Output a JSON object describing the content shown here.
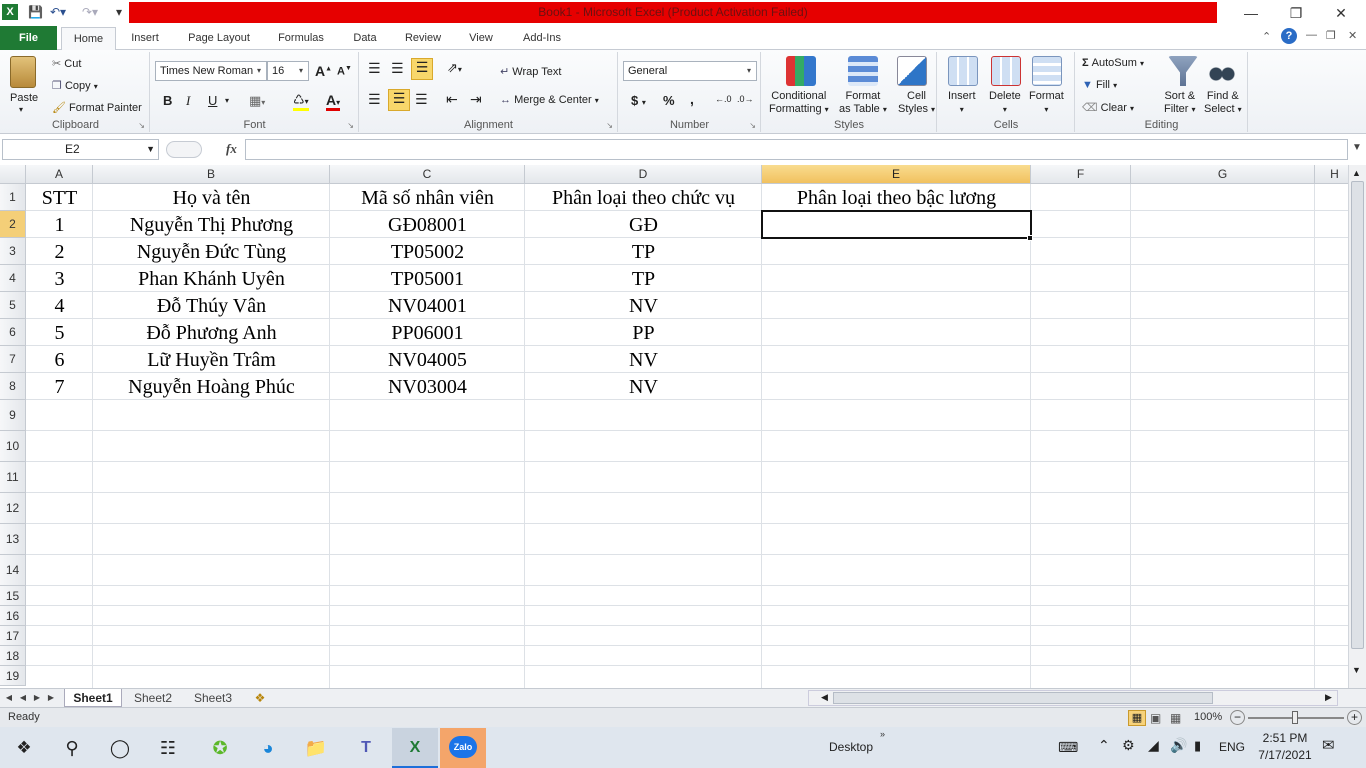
{
  "window": {
    "title": "Book1  -  Microsoft Excel (Product Activation Failed)"
  },
  "tabs": [
    "File",
    "Home",
    "Insert",
    "Page Layout",
    "Formulas",
    "Data",
    "Review",
    "View",
    "Add-Ins"
  ],
  "ribbon": {
    "clipboard": {
      "label": "Clipboard",
      "paste": "Paste",
      "cut": "Cut",
      "copy": "Copy",
      "format_painter": "Format Painter"
    },
    "font": {
      "label": "Font",
      "name": "Times New Roman",
      "size": "16",
      "bold": "B",
      "italic": "I",
      "underline": "U"
    },
    "alignment": {
      "label": "Alignment",
      "wrap_text": "Wrap Text",
      "merge_center": "Merge & Center"
    },
    "number": {
      "label": "Number",
      "format": "General",
      "currency": "$",
      "percent": "%",
      "comma": ","
    },
    "styles": {
      "label": "Styles",
      "conditional": "Conditional",
      "conditional2": "Formatting",
      "format_table": "Format",
      "format_table2": "as Table",
      "cell_styles": "Cell",
      "cell_styles2": "Styles"
    },
    "cells": {
      "label": "Cells",
      "insert": "Insert",
      "delete": "Delete",
      "format": "Format"
    },
    "editing": {
      "label": "Editing",
      "autosum": "AutoSum",
      "fill": "Fill",
      "clear": "Clear",
      "sort": "Sort &",
      "sort2": "Filter",
      "find": "Find &",
      "find2": "Select"
    }
  },
  "formula_bar": {
    "name_box": "E2",
    "fx": "fx",
    "formula": ""
  },
  "columns": [
    "A",
    "B",
    "C",
    "D",
    "E",
    "F",
    "G",
    "H"
  ],
  "rows": [
    "1",
    "2",
    "3",
    "4",
    "5",
    "6",
    "7",
    "8",
    "9",
    "10",
    "11",
    "12",
    "13",
    "14",
    "15",
    "16",
    "17",
    "18",
    "19"
  ],
  "header_row": [
    "STT",
    "Họ và tên",
    "Mã số nhân viên",
    "Phân loại theo chức vụ",
    "Phân loại theo bậc lương"
  ],
  "data_rows": [
    [
      "1",
      "Nguyễn Thị Phương",
      "GĐ08001",
      "GĐ"
    ],
    [
      "2",
      "Nguyễn Đức Tùng",
      "TP05002",
      "TP"
    ],
    [
      "3",
      "Phan Khánh Uyên",
      "TP05001",
      "TP"
    ],
    [
      "4",
      "Đỗ Thúy Vân",
      "NV04001",
      "NV"
    ],
    [
      "5",
      "Đỗ Phương Anh",
      "PP06001",
      "PP"
    ],
    [
      "6",
      "Lữ Huyền Trâm",
      "NV04005",
      "NV"
    ],
    [
      "7",
      "Nguyễn Hoàng Phúc",
      "NV03004",
      "NV"
    ]
  ],
  "sheets": [
    "Sheet1",
    "Sheet2",
    "Sheet3"
  ],
  "status": {
    "ready": "Ready",
    "zoom": "100%"
  },
  "taskbar": {
    "desktop": "Desktop",
    "lang": "ENG",
    "time": "2:51 PM",
    "date": "7/17/2021",
    "zalo": "Zalo"
  }
}
